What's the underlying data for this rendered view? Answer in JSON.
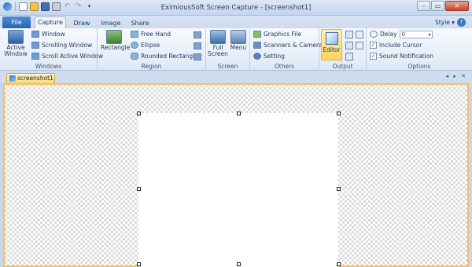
{
  "window": {
    "title": "EximiousSoft Screen Capture - [screenshot1]",
    "controls": [
      "–",
      "▭",
      "✕"
    ]
  },
  "quick_access": {
    "icons": [
      "app-icon",
      "new-icon",
      "open-icon",
      "save-icon",
      "print-icon",
      "undo-icon",
      "redo-icon",
      "customize-icon"
    ]
  },
  "tabs": {
    "file": "File",
    "items": [
      "Capture",
      "Draw",
      "Image",
      "Share"
    ],
    "active": "Capture",
    "style_menu": "Style ▾",
    "help": "?"
  },
  "ribbon": {
    "windows": {
      "label": "Windows",
      "active_window": "Active Window",
      "window": "Window",
      "scrolling_window": "Scrolling Window",
      "scroll_active_window": "Scroll Active Window"
    },
    "region": {
      "label": "Region",
      "rectangle": "Rectangle",
      "free_hand": "Free Hand",
      "ellipse": "Ellipse",
      "rounded_rectangle": "Rounded Rectangle"
    },
    "screen": {
      "label": "Screen",
      "full_screen": "Full Screen",
      "menu": "Menu"
    },
    "others": {
      "label": "Others",
      "graphics_file": "Graphics File",
      "scanners_cameras": "Scanners & Cameras",
      "setting": "Setting"
    },
    "output": {
      "label": "Output",
      "editor": "Editor"
    },
    "options": {
      "label": "Options",
      "delay_label": "Delay",
      "delay_value": "0",
      "include_cursor": "Include Cursor",
      "include_cursor_checked": true,
      "sound_notification": "Sound Notification",
      "sound_notification_checked": true
    }
  },
  "document": {
    "tab_name": "screenshot1",
    "nav": "◂ ▸ ✕"
  },
  "colors": {
    "accent": "#2662b3",
    "canvas_border": "#f3bf6a",
    "active_tab": "#f9d77a"
  }
}
